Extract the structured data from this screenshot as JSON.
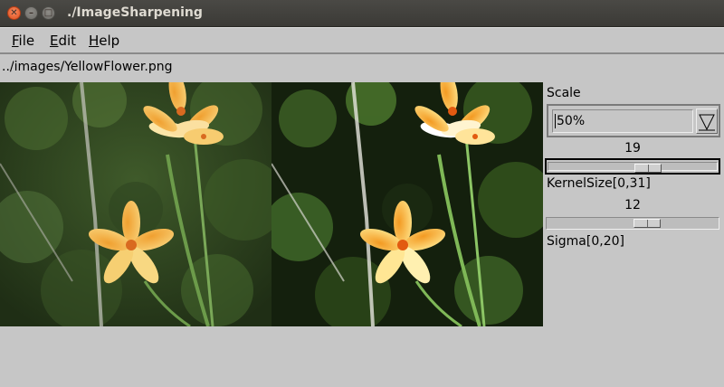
{
  "window": {
    "title": "./ImageSharpening"
  },
  "menu": {
    "file_mnemonic": "F",
    "file_rest": "ile",
    "edit_mnemonic": "E",
    "edit_rest": "dit",
    "help_mnemonic": "H",
    "help_rest": "elp"
  },
  "filepath": "../images/YellowFlower.png",
  "scale": {
    "label": "Scale",
    "value": "50%"
  },
  "kernel": {
    "value": "19",
    "label": "KernelSize[0,31]",
    "level_fraction": 0.61
  },
  "sigma": {
    "value": "12",
    "label": "Sigma[0,20]",
    "level_fraction": 0.6
  },
  "icons": {
    "combo_arrow": "down-triangle-icon",
    "close": "close-icon",
    "minimize": "minimize-icon",
    "maximize": "maximize-icon"
  }
}
